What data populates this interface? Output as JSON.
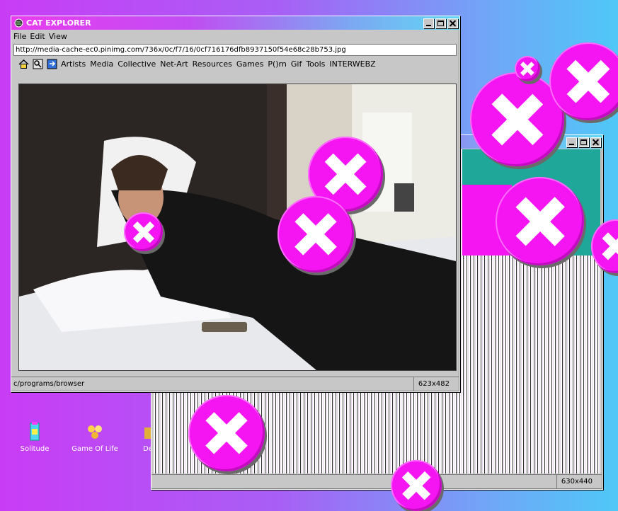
{
  "browser": {
    "title": "CAT EXPLORER",
    "menu": [
      "File",
      "Edit",
      "View"
    ],
    "address": "http://media-cache-ec0.pinimg.com/736x/0c/f7/16/0cf716176dfb8937150f54e68c28b753.jpg",
    "links": [
      "Artists",
      "Media",
      "Collective",
      "Net-Art",
      "Resources",
      "Games",
      "P()rn",
      "Gif",
      "Tools",
      "INTERWEBZ"
    ],
    "status_path": "c/programs/browser",
    "status_size": "623x482"
  },
  "second_window": {
    "status_size": "630x440"
  },
  "desktop_icons": [
    {
      "label": "Solitude"
    },
    {
      "label": "Game Of Life"
    },
    {
      "label": "De"
    }
  ],
  "colors": {
    "accent_magenta": "#f515f2",
    "title_gradient_start": "#e83cf0",
    "title_gradient_end": "#5fd8f4"
  }
}
